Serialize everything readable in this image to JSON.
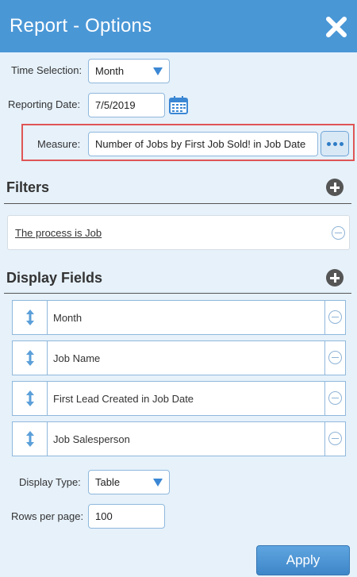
{
  "header": {
    "title": "Report - Options"
  },
  "time_selection": {
    "label": "Time Selection:",
    "value": "Month"
  },
  "reporting_date": {
    "label": "Reporting Date:",
    "value": "7/5/2019"
  },
  "measure": {
    "label": "Measure:",
    "value": "Number of Jobs by First Job Sold! in Job Date"
  },
  "filters": {
    "title": "Filters",
    "items": [
      {
        "label": "The process is Job"
      }
    ]
  },
  "display_fields": {
    "title": "Display Fields",
    "items": [
      {
        "label": "Month"
      },
      {
        "label": "Job Name"
      },
      {
        "label": "First Lead Created in Job Date"
      },
      {
        "label": "Job Salesperson"
      }
    ]
  },
  "display_type": {
    "label": "Display Type:",
    "value": "Table"
  },
  "rows_per_page": {
    "label": "Rows per page:",
    "value": "100"
  },
  "apply_label": "Apply",
  "colors": {
    "header": "#4a97d6",
    "background": "#e6f1fa",
    "accent": "#3b87d4",
    "highlight": "#e05555"
  }
}
